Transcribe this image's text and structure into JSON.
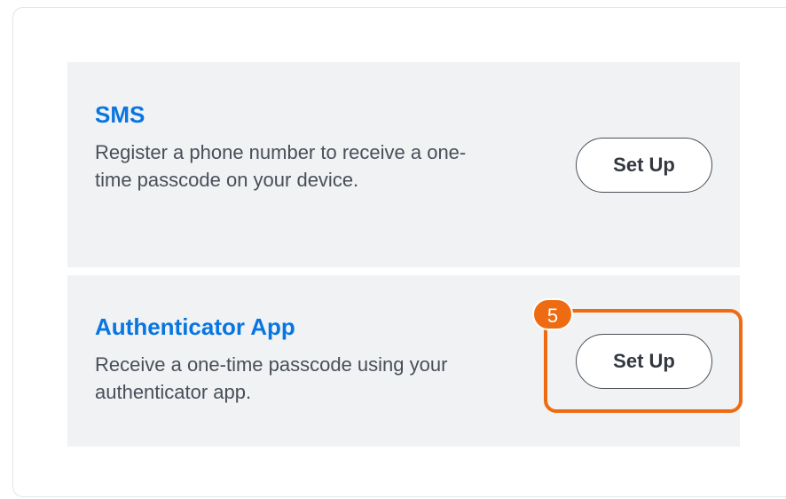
{
  "options": [
    {
      "title": "SMS",
      "description": "Register a phone number to receive a one-time passcode on your device.",
      "button_label": "Set Up"
    },
    {
      "title": "Authenticator App",
      "description": "Receive a one-time passcode using your authenticator app.",
      "button_label": "Set Up"
    }
  ],
  "annotation": {
    "step_number": "5",
    "color": "#ee6b12"
  },
  "colors": {
    "title": "#0875e1",
    "panel_background": "#f0f2f4",
    "description_text": "#494f58"
  }
}
